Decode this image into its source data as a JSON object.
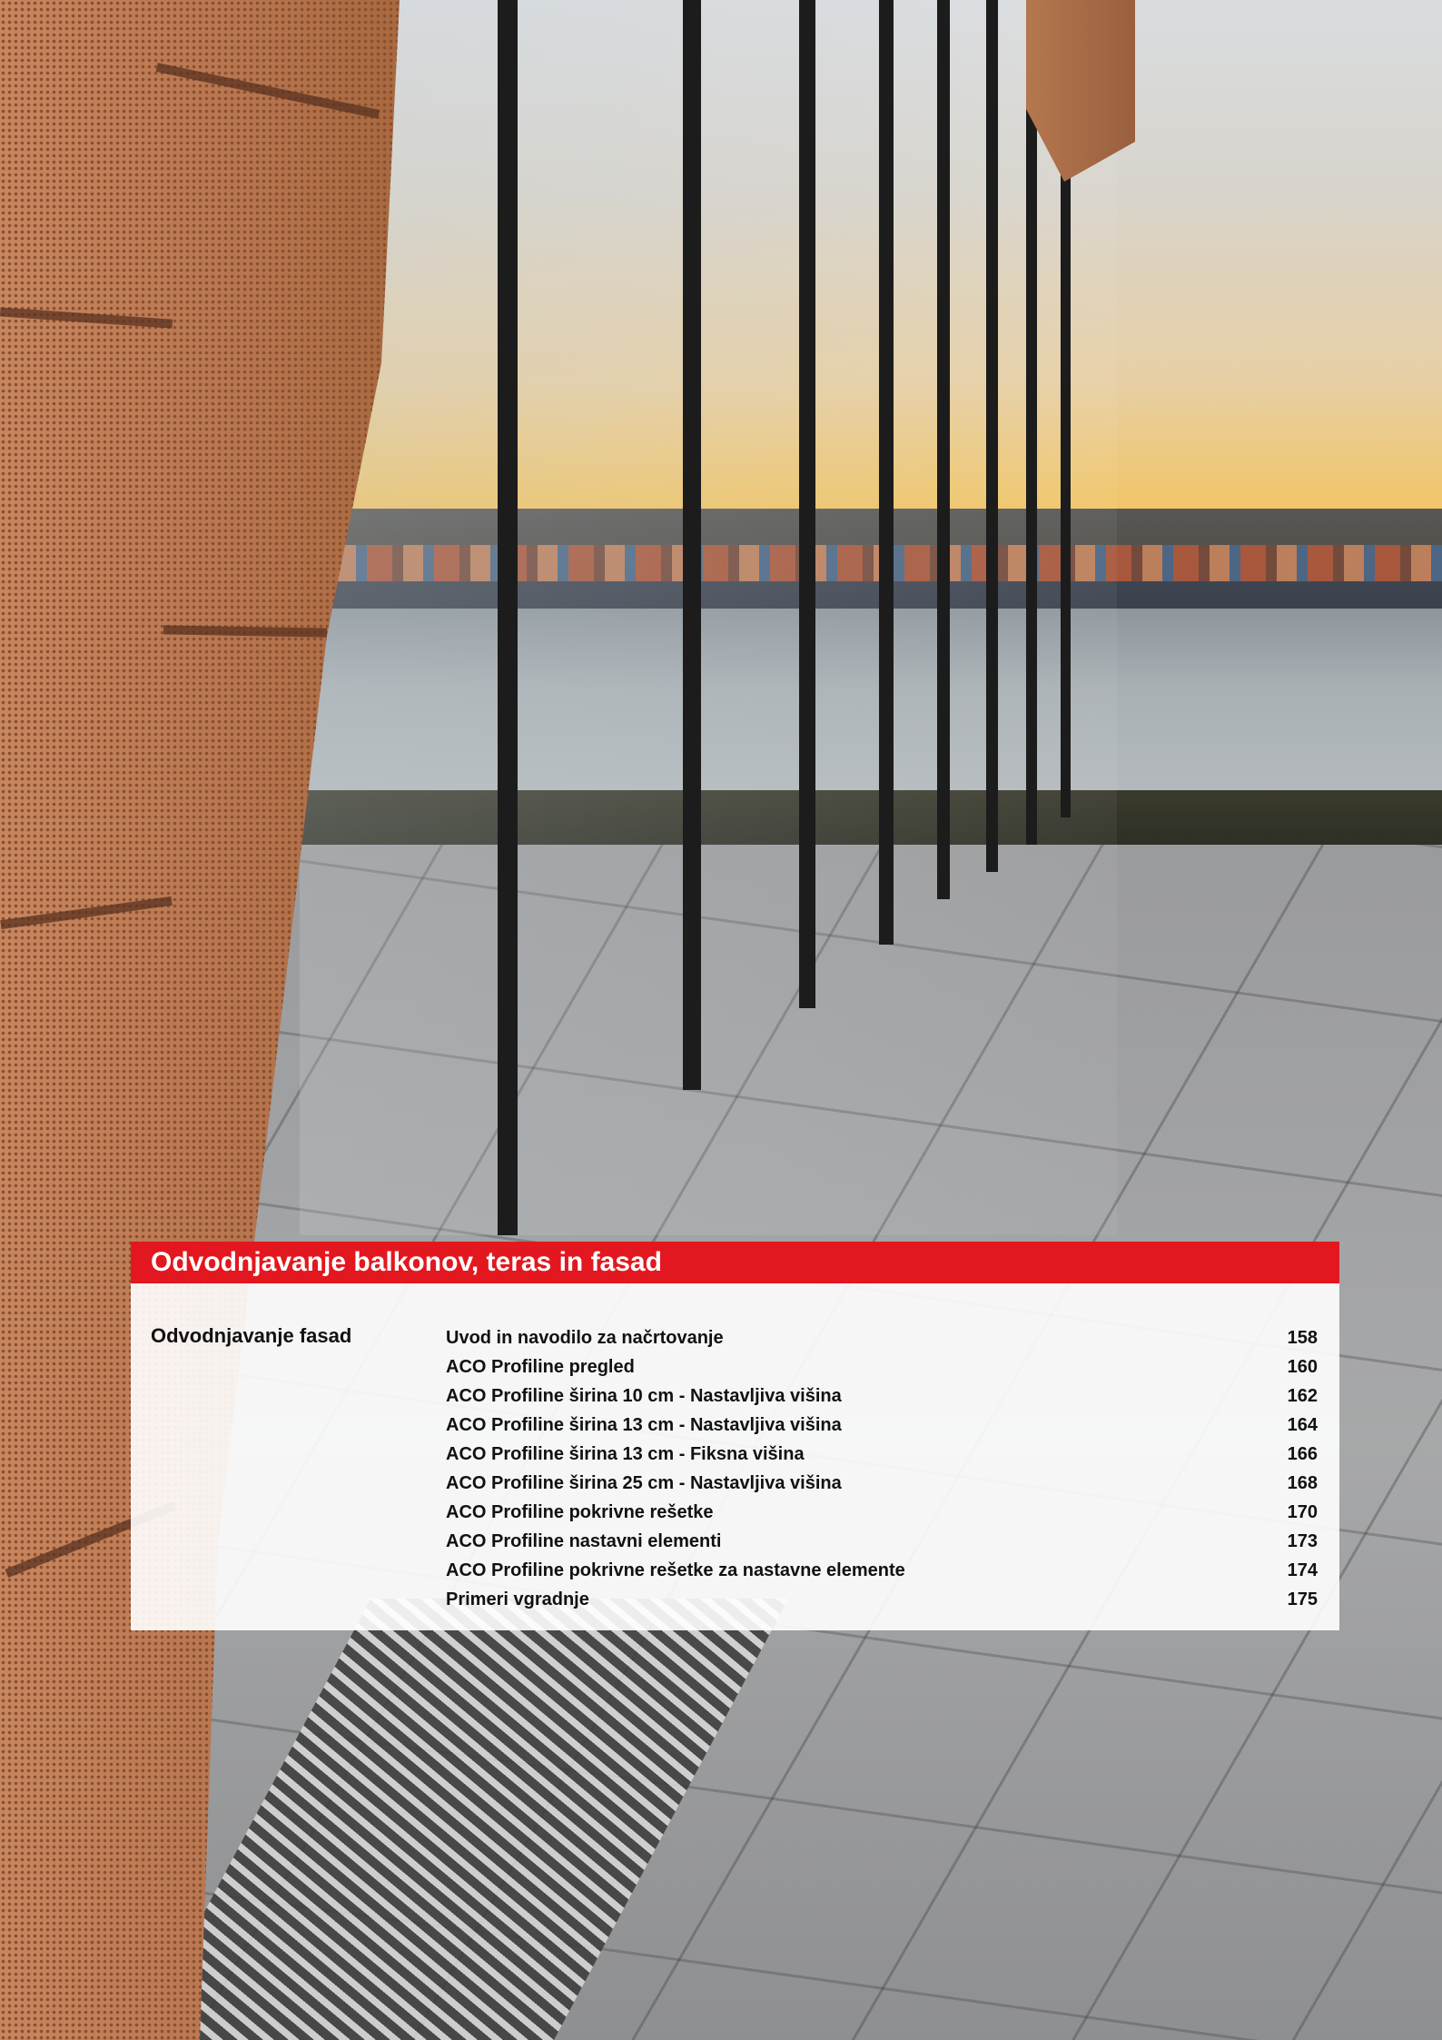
{
  "panel": {
    "title": "Odvodnjavanje balkonov, teras in fasad",
    "title_bar_color": "#e3171f",
    "section": "Odvodnjavanje fasad",
    "entries": [
      {
        "label": "Uvod in navodilo za načrtovanje",
        "page": "158"
      },
      {
        "label": "ACO Profiline pregled",
        "page": "160"
      },
      {
        "label": "ACO Profiline širina 10 cm - Nastavljiva višina",
        "page": "162"
      },
      {
        "label": "ACO Profiline širina 13 cm - Nastavljiva višina",
        "page": "164"
      },
      {
        "label": "ACO Profiline širina 13 cm - Fiksna višina",
        "page": "166"
      },
      {
        "label": "ACO Profiline širina 25 cm - Nastavljiva višina",
        "page": "168"
      },
      {
        "label": "ACO Profiline pokrivne rešetke",
        "page": "170"
      },
      {
        "label": "ACO Profiline nastavni elementi",
        "page": "173"
      },
      {
        "label": "ACO Profiline pokrivne rešetke za nastavne elemente",
        "page": "174"
      },
      {
        "label": "Primeri vgradnje",
        "page": "175"
      }
    ]
  }
}
